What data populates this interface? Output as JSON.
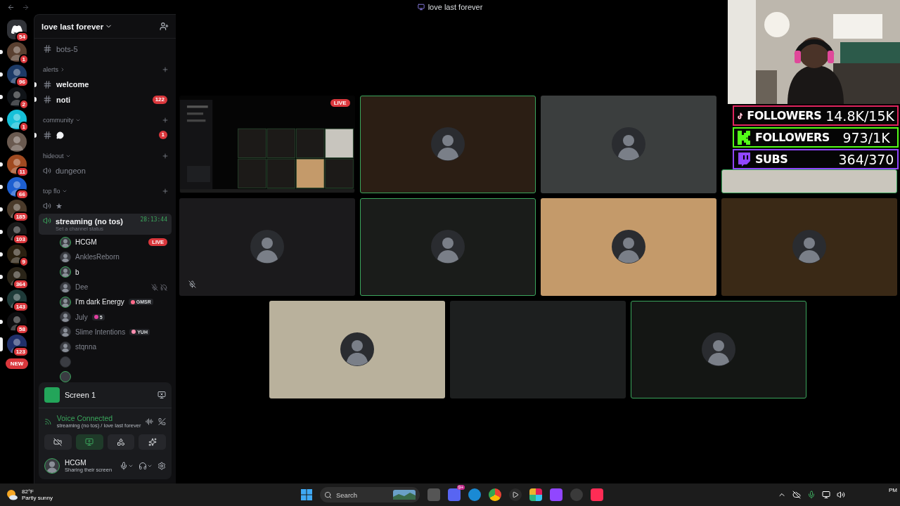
{
  "window": {
    "title": "love last forever"
  },
  "servers": [
    {
      "badge": "54",
      "kind": "home",
      "unread": false,
      "selected": false,
      "color": "#313338"
    },
    {
      "badge": "1",
      "kind": "server",
      "unread": true,
      "selected": false,
      "color": "#5a4030"
    },
    {
      "badge": "96",
      "kind": "server",
      "unread": true,
      "selected": false,
      "color": "#1c3a66"
    },
    {
      "badge": "2",
      "kind": "server",
      "unread": true,
      "selected": false,
      "color": "#101418"
    },
    {
      "badge": "1",
      "kind": "server",
      "unread": true,
      "selected": false,
      "color": "#16c0d8"
    },
    {
      "kind": "server",
      "unread": false,
      "selected": false,
      "color": "#6a5a50"
    },
    {
      "badge": "11",
      "kind": "server",
      "unread": true,
      "selected": false,
      "color": "#a04a20"
    },
    {
      "badge": "66",
      "kind": "server",
      "unread": true,
      "selected": false,
      "color": "#1d5fd0"
    },
    {
      "badge": "185",
      "kind": "server",
      "unread": true,
      "selected": false,
      "color": "#4a3a2a"
    },
    {
      "badge": "103",
      "kind": "server",
      "unread": true,
      "selected": false,
      "color": "#1a1a1a"
    },
    {
      "badge": "9",
      "kind": "server",
      "unread": true,
      "selected": false,
      "color": "#2a2010"
    },
    {
      "badge": "364",
      "kind": "server",
      "unread": true,
      "selected": false,
      "color": "#2a2418"
    },
    {
      "badge": "143",
      "kind": "server",
      "unread": true,
      "selected": false,
      "color": "#1e3a38"
    },
    {
      "badge": "58",
      "kind": "server",
      "unread": true,
      "selected": false,
      "color": "#0e0e10"
    },
    {
      "badge": "123",
      "kind": "server",
      "unread": true,
      "selected": true,
      "color": "#20306a"
    }
  ],
  "new_pill": "NEW",
  "server_name": "love last forever",
  "channels": [
    {
      "kind": "text",
      "name": "bots-5",
      "unread": false
    },
    {
      "kind": "category",
      "name": "alerts",
      "expanded": false
    },
    {
      "kind": "text",
      "name": "welcome",
      "unread": true
    },
    {
      "kind": "text",
      "name": "noti",
      "unread": true,
      "badge": "122"
    },
    {
      "kind": "category",
      "name": "community",
      "expanded": true
    },
    {
      "kind": "text",
      "unread": true,
      "badge": "1"
    },
    {
      "kind": "category",
      "name": "hideout",
      "expanded": true
    },
    {
      "kind": "voice",
      "name": "dungeon",
      "selected": false
    },
    {
      "kind": "category",
      "name": "top flo",
      "expanded": true
    },
    {
      "kind": "voice",
      "name": "★",
      "selected": false
    },
    {
      "kind": "voice",
      "name": "streaming (no tos)",
      "selected": true,
      "status": "Set a channel status",
      "timer": "28:13:44"
    }
  ],
  "members": [
    {
      "name": "HCGM",
      "speaking": true,
      "live": "LIVE",
      "muted": false
    },
    {
      "name": "AnklesReborn",
      "speaking": false,
      "muted": false
    },
    {
      "name": "b",
      "speaking": true,
      "muted": false
    },
    {
      "name": "Dee",
      "speaking": false,
      "muted": true
    },
    {
      "name": "I'm dark Energy",
      "speaking": true,
      "muted": false,
      "tag": "GMSR",
      "color": "#ff6b8a"
    },
    {
      "name": "July",
      "speaking": false,
      "muted": false,
      "tag": "5",
      "color": "#e040a0"
    },
    {
      "name": "Slime Intentions",
      "speaking": false,
      "muted": false,
      "tag": "YUH",
      "color": "#ff8fb0"
    },
    {
      "name": "stqnna",
      "speaking": false,
      "muted": false
    },
    {
      "speaking": false,
      "muted": false
    },
    {
      "speaking": true,
      "muted": false
    }
  ],
  "stream": {
    "name": "Screen 1"
  },
  "voice": {
    "status": "Voice Connected",
    "channel": "streaming (no tos) / love last forever"
  },
  "controls": [
    {
      "kind": "camera",
      "active": false
    },
    {
      "kind": "screen",
      "active": true
    },
    {
      "kind": "activities",
      "active": false
    },
    {
      "kind": "soundboard",
      "active": false
    }
  ],
  "user": {
    "name": "HCGM",
    "status": "Sharing their screen"
  },
  "tiles": [
    [
      {
        "kind": "stream",
        "live": "LIVE",
        "speaking": false,
        "muted": false
      },
      {
        "kind": "user",
        "color": "#2b1e14",
        "speaking": true,
        "muted": false
      },
      {
        "kind": "user",
        "color": "#3b3e3e",
        "speaking": false,
        "muted": false
      },
      {
        "kind": "partial",
        "color": "#cac6bd",
        "speaking": true
      }
    ],
    [
      {
        "kind": "user",
        "color": "#1b1a1c",
        "speaking": false,
        "muted": true
      },
      {
        "kind": "user",
        "color": "#1a1c1a",
        "speaking": true,
        "muted": false
      },
      {
        "kind": "user",
        "color": "#c49a6a",
        "speaking": false,
        "muted": false
      },
      {
        "kind": "user",
        "color": "#3a2916",
        "speaking": false,
        "muted": false
      }
    ],
    [
      {
        "kind": "user",
        "color": "#b9b19c",
        "speaking": false,
        "muted": false
      },
      {
        "kind": "empty",
        "color": "#1d1f1f",
        "speaking": false,
        "muted": false
      },
      {
        "kind": "user",
        "color": "#141614",
        "speaking": true,
        "muted": false
      }
    ]
  ],
  "goals": [
    {
      "kind": "tiktok",
      "label": "FOLLOWERS",
      "value": "14.8K/15K",
      "color": "#e0245e"
    },
    {
      "kind": "kick",
      "label": "FOLLOWERS",
      "value": "973/1K",
      "color": "#53fc18"
    },
    {
      "kind": "twitch",
      "label": "SUBS",
      "value": "364/370",
      "color": "#9146ff"
    }
  ],
  "taskbar": {
    "weather": {
      "temp": "82°F",
      "condition": "Partly sunny"
    },
    "search": {
      "placeholder": "Search"
    },
    "discord_badge": "9+",
    "time": "PM"
  }
}
